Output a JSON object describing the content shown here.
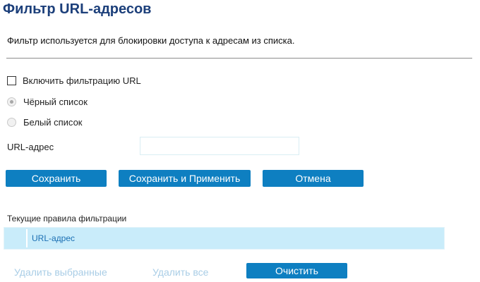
{
  "page": {
    "title": "Фильтр URL-адресов",
    "description": "Фильтр используется для блокировки доступа к адресам из списка."
  },
  "filter": {
    "enable_label": "Включить фильтрацию URL",
    "enabled": false,
    "mode_options": [
      {
        "label": "Чёрный список",
        "selected": true
      },
      {
        "label": "Белый список",
        "selected": false
      }
    ],
    "url_label": "URL-адрес",
    "url_value": ""
  },
  "actions": {
    "save_label": "Сохранить",
    "save_apply_label": "Сохранить и Применить",
    "cancel_label": "Отмена"
  },
  "rules": {
    "title": "Текущие правила фильтрации",
    "columns": [
      "",
      "URL-адрес"
    ],
    "rows": []
  },
  "rule_actions": {
    "delete_selected_label": "Удалить выбранные",
    "delete_all_label": "Удалить все",
    "clear_label": "Очистить"
  },
  "colors": {
    "title": "#1c3f7a",
    "button": "#0e7fc1",
    "table_header": "#c9ecfa",
    "disabled_link": "#a9cde6"
  }
}
